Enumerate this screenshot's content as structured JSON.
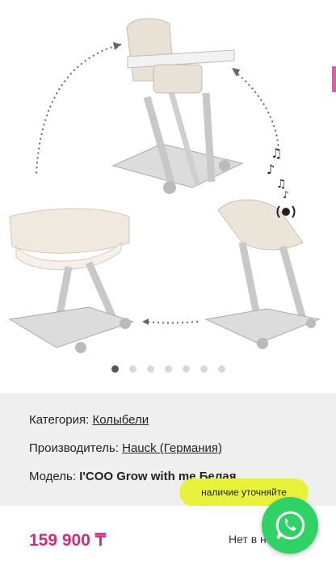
{
  "gallery": {
    "slide_count": 7,
    "active_index": 0
  },
  "details": {
    "category_label": "Категория:",
    "category_value": "Колыбели",
    "maker_label": "Производитель:",
    "maker_value": "Hauck (Германия)",
    "model_label": "Модель:",
    "model_value": "I'COO Grow with me Белая"
  },
  "availability_button": "наличие уточняйте",
  "price": "159 900 ₸",
  "stock_status": "Нет в н",
  "colors": {
    "price": "#d12c7c",
    "pill": "#e9f23a",
    "whatsapp": "#2fd365",
    "info_bg": "#efefef"
  },
  "icons": [
    "music-note-icon",
    "speaker-icon",
    "whatsapp-icon"
  ]
}
